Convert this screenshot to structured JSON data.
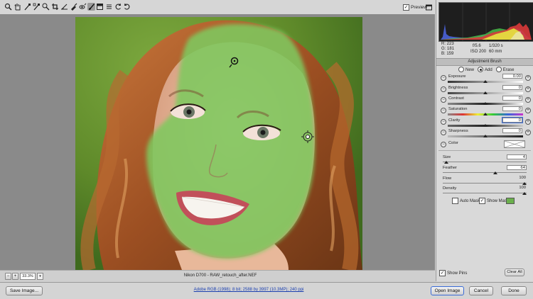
{
  "toolbar": {
    "tools": [
      "zoom-icon",
      "hand-icon",
      "white-balance-icon",
      "color-sampler-icon",
      "target-adjust-icon",
      "crop-icon",
      "straighten-icon",
      "spot-removal-icon",
      "red-eye-icon",
      "adjustment-brush-icon",
      "graduated-filter-icon",
      "preferences-icon",
      "rotate-ccw-icon",
      "rotate-cw-icon"
    ],
    "preview_label": "Preview",
    "preview_checked": "✓"
  },
  "status": {
    "zoom": "33.3%",
    "filename": "Nikon D700  -  RAW_retouch_after.NEF"
  },
  "info": {
    "r_label": "R:",
    "r_value": "223",
    "g_label": "G:",
    "g_value": "181",
    "b_label": "B:",
    "b_value": "159",
    "aperture": "f/5.6",
    "shutter": "1/320 s",
    "iso": "ISO 200",
    "focal": "60 mm"
  },
  "panel": {
    "title": "Adjustment Brush",
    "mode_new": "New",
    "mode_add": "Add",
    "mode_erase": "Erase",
    "sliders": [
      {
        "label": "Exposure",
        "value": "0.00"
      },
      {
        "label": "Brightness",
        "value": "0"
      },
      {
        "label": "Contrast",
        "value": "0"
      },
      {
        "label": "Saturation",
        "value": "0"
      },
      {
        "label": "Clarity",
        "value": "0"
      },
      {
        "label": "Sharpness",
        "value": "0"
      }
    ],
    "color_label": "Color",
    "brush": [
      {
        "label": "Size",
        "value": "4"
      },
      {
        "label": "Feather",
        "value": "64"
      },
      {
        "label": "Flow",
        "value": "100"
      },
      {
        "label": "Density",
        "value": "100"
      }
    ],
    "auto_mask": "Auto Mask",
    "show_mask": "Show Mask",
    "show_mask_checked": "✓",
    "show_pins": "Show Pins",
    "show_pins_checked": "✓",
    "clear_all": "Clear All",
    "mask_color": "#6ab04c"
  },
  "bottom": {
    "save_image": "Save Image...",
    "workflow": "Adobe RGB (1998); 8 bit; 2588 by 3997 (10.3MP); 240 ppi",
    "open_image": "Open Image",
    "cancel": "Cancel",
    "done": "Done"
  }
}
